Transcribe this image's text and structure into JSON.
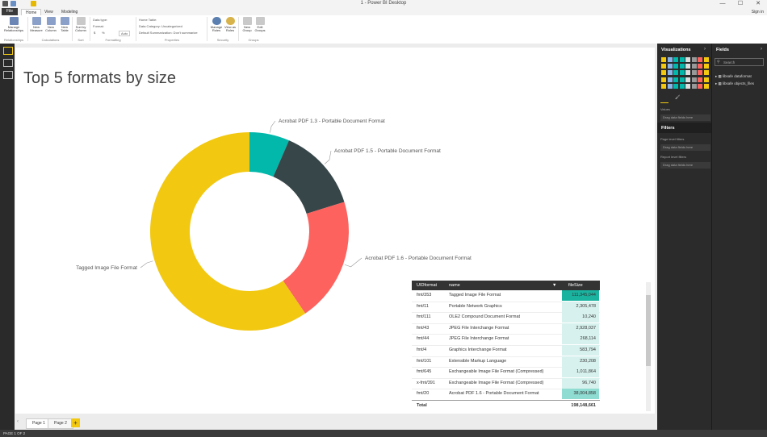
{
  "window": {
    "title": "1 - Power BI Desktop",
    "min": "—",
    "max": "☐",
    "close": "✕"
  },
  "menu": {
    "file": "File",
    "tabs": [
      "Home",
      "View",
      "Modeling"
    ],
    "signin": "Sign in"
  },
  "ribbon": {
    "manage_relationships": "Manage Relationships",
    "new_measure": "New Measure",
    "new_column": "New Column",
    "new_table": "New Table",
    "sort_by_column": "Sort by Column",
    "data_type": "Data type:",
    "format": "Format:",
    "dollar": "$",
    "percent": "%",
    "auto": "Auto",
    "home_table": "Home Table:",
    "data_category": "Data Category: Uncategorized",
    "default_summarization": "Default Summarization: Don't summarize",
    "manage_roles": "Manage Roles",
    "view_as_roles": "View as Roles",
    "new_group": "New Group",
    "edit_groups": "Edit Groups",
    "groups": [
      "Relationships",
      "Calculations",
      "Sort",
      "Formatting",
      "Properties",
      "Security",
      "Groups"
    ]
  },
  "report": {
    "title": "Top 5 formats by size"
  },
  "chart_data": {
    "type": "pie",
    "subtype": "donut",
    "labels": [
      "Tagged Image File Format",
      "Acrobat PDF 1.3 - Portable Document Format",
      "Acrobat PDF 1.5 - Portable Document Format",
      "Acrobat PDF 1.6 - Portable Document Format"
    ],
    "values": [
      111345044,
      12200000,
      25600000,
      38004858
    ],
    "colors": [
      "#f2c811",
      "#01b8aa",
      "#374649",
      "#fd625e"
    ]
  },
  "table": {
    "headers": [
      "UIDformat",
      "name",
      "fileSize"
    ],
    "rows": [
      [
        "fmt/353",
        "Tagged Image File Format",
        "111,345,044"
      ],
      [
        "fmt/11",
        "Portable Network Graphics",
        "2,305,478"
      ],
      [
        "fmt/111",
        "OLE2 Compound Document Format",
        "10,240"
      ],
      [
        "fmt/43",
        "JPEG File Interchange Format",
        "2,928,037"
      ],
      [
        "fmt/44",
        "JPEG File Interchange Format",
        "268,114"
      ],
      [
        "fmt/4",
        "Graphics Interchange Format",
        "583,794"
      ],
      [
        "fmt/101",
        "Extensible Markup Language",
        "230,208"
      ],
      [
        "fmt/645",
        "Exchangeable Image File Format (Compressed)",
        "1,011,864"
      ],
      [
        "x-fmt/391",
        "Exchangeable Image File Format (Compressed)",
        "96,740"
      ],
      [
        "fmt/20",
        "Acrobat PDF 1.6 - Portable Document Format",
        "38,004,858"
      ]
    ],
    "total_label": "Total",
    "total_value": "198,148,661"
  },
  "pages": {
    "tabs": [
      "Page 1",
      "Page 2"
    ],
    "add": "+"
  },
  "status": "PAGE 1 OF 2",
  "viz_pane": {
    "title": "Visualizations",
    "values_label": "Values",
    "drag_here": "Drag data fields here",
    "filters_title": "Filters",
    "page_filters": "Page level filters",
    "report_filters": "Report level filters"
  },
  "fields_pane": {
    "title": "Fields",
    "search_placeholder": "Search",
    "tables": [
      "libsafe dataformat",
      "libsafe objects_files"
    ]
  }
}
